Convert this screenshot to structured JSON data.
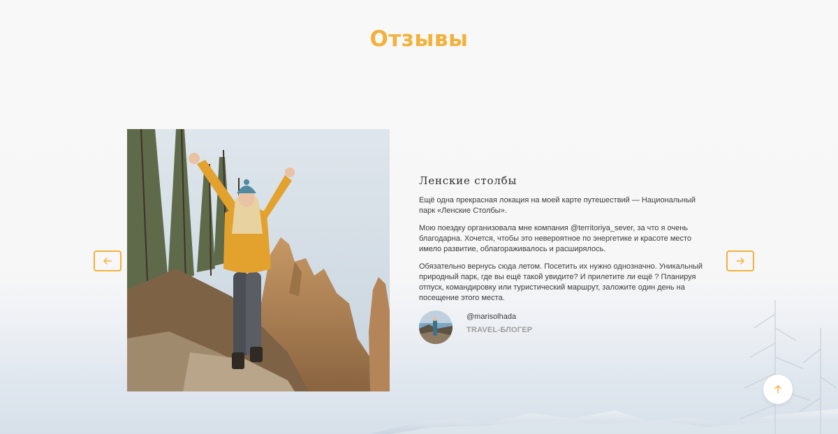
{
  "section": {
    "title": "Отзывы"
  },
  "review": {
    "title": "Ленские столбы",
    "paragraphs": [
      "Ещё одна прекрасная локация на моей карте путешествий — Национальный парк «Ленские Столбы».",
      "Мою поездку организовала мне компания @territoriya_sever, за что я очень благодарна. Хочется, чтобы это невероятное по энергетике и красоте место имело развитие, облагораживалось и расширялось.",
      "Обязательно вернусь сюда летом. Посетить их нужно однозначно. Уникальный природный парк, где вы ещё такой увидите? И прилетите ли ещё ? Планируя отпуск, командировку или туристический маршрут, заложите один день на посещение этого места."
    ],
    "author": {
      "handle": "@marisolhada",
      "role": "TRAVEL-БЛОГЕР"
    }
  },
  "icons": {
    "prev": "arrow-left-icon",
    "next": "arrow-right-icon",
    "scroll_top": "arrow-up-icon"
  },
  "colors": {
    "accent": "#f3b13a",
    "text": "#3a3a3a",
    "muted": "#9b9b9b"
  }
}
